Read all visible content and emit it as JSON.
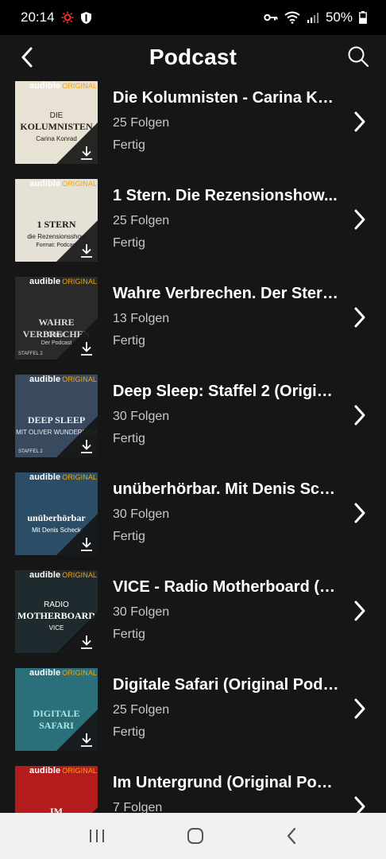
{
  "status": {
    "time": "20:14",
    "battery": "50%"
  },
  "header": {
    "title": "Podcast"
  },
  "items": [
    {
      "title": "Die Kolumnisten - Carina Kon...",
      "count": "25 Folgen",
      "state": "Fertig",
      "cover": {
        "brand": "audible",
        "brand_orig": "ORIGINAL",
        "text": "KOLUMNISTEN",
        "subtext": "Carina Konrad",
        "prefix": "DIE",
        "bg": "#e8e2d4",
        "fg": "#2a2318"
      }
    },
    {
      "title": "1 Stern. Die Rezensionshow...",
      "count": "25 Folgen",
      "state": "Fertig",
      "cover": {
        "brand": "audible",
        "brand_orig": "ORIGINAL",
        "text": "1 STERN",
        "subtext": "die Rezensionsshow",
        "note": "Format: Podcast",
        "bg": "#e6e1d6",
        "fg": "#1a1a1a"
      }
    },
    {
      "title": "Wahre Verbrechen. Der Stern...",
      "count": "13 Folgen",
      "state": "Fertig",
      "cover": {
        "brand": "audible",
        "brand_orig": "ORIGINAL",
        "text": "WAHRE VERBRECHEN",
        "subtext": "Crime",
        "note": "Der Podcast",
        "season": "STAFFEL 2",
        "bg": "#2a2a2a",
        "fg": "#d9d9d9"
      }
    },
    {
      "title": "Deep Sleep: Staffel 2 (Origina...",
      "count": "30 Folgen",
      "state": "Fertig",
      "cover": {
        "brand": "audible",
        "brand_orig": "ORIGINAL",
        "text": "DEEP SLEEP",
        "subtext": "MIT OLIVER WUNDERLICH",
        "season": "STAFFEL 2",
        "bg": "#3a4a5e",
        "fg": "#e6edf3"
      }
    },
    {
      "title": "unüberhörbar. Mit Denis Sch...",
      "count": "30 Folgen",
      "state": "Fertig",
      "cover": {
        "brand": "audible",
        "brand_orig": "ORIGINAL",
        "text": "unüberhörbar",
        "subtext": "Mit Denis Scheck",
        "bg": "#2b4e66",
        "fg": "#ffffff"
      }
    },
    {
      "title": "VICE - Radio Motherboard (Or...",
      "count": "30 Folgen",
      "state": "Fertig",
      "cover": {
        "brand": "audible",
        "brand_orig": "ORIGINAL",
        "text": "MOTHERBOARD",
        "prefix": "RADIO",
        "subtext": "VICE",
        "bg": "#1e2a2e",
        "fg": "#ffffff"
      }
    },
    {
      "title": "Digitale Safari (Original Podc...",
      "count": "25 Folgen",
      "state": "Fertig",
      "cover": {
        "brand": "audible",
        "brand_orig": "ORIGINAL",
        "text": "DIGITALE SAFARI",
        "bg": "#2a6f7a",
        "fg": "#a8e8e0"
      }
    },
    {
      "title": "Im Untergrund (Original Podc...",
      "count": "7 Folgen",
      "state": "",
      "cover": {
        "brand": "audible",
        "brand_orig": "ORIGINAL",
        "text": "IM UNTERGRUND",
        "bg": "#b31c1c",
        "fg": "#ffffff"
      }
    }
  ]
}
